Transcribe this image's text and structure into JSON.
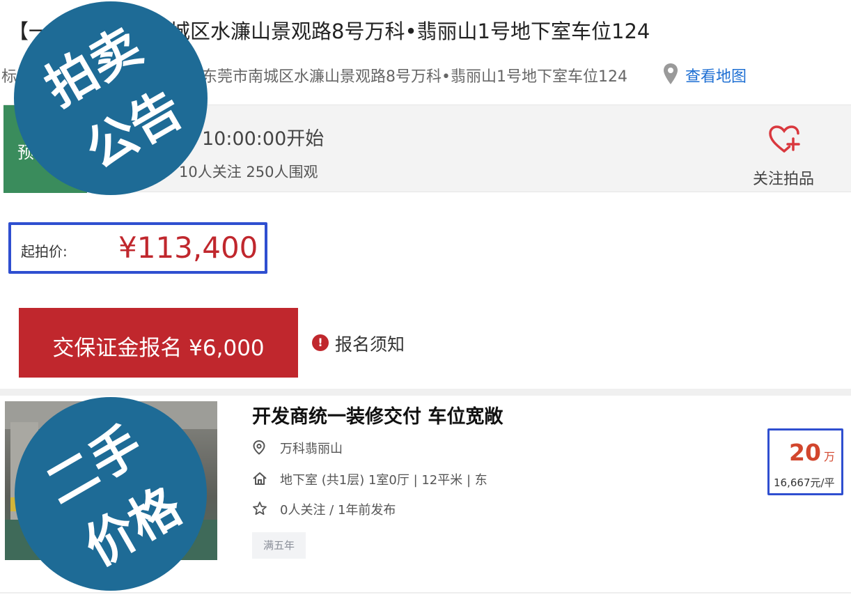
{
  "header": {
    "title": "【一拍】东莞市南城区水濂山景观路8号万科•翡丽山1号地下室车位124",
    "address_prefix": "标",
    "address": "东莞市南城区水濂山景观路8号万科•翡丽山1号地下室车位124",
    "map_link": "查看地图"
  },
  "status": {
    "badge": "预",
    "start_time": "10:00:00开始",
    "stats": "10人关注  250人围观",
    "follow_label": "关注拍品"
  },
  "auction": {
    "start_price_label": "起拍价:",
    "start_price": "¥113,400",
    "signup_button": "交保证金报名 ¥6,000",
    "notice_icon": "!",
    "notice_text": "报名须知"
  },
  "listing": {
    "title": "开发商统一装修交付 车位宽敞",
    "location": "万科翡丽山",
    "info": "地下室 (共1层) 1室0厅 | 12平米 | 东",
    "follow": "0人关注 / 1年前发布",
    "tag": "满五年",
    "total_price": "20",
    "total_unit": "万",
    "unit_price": "16,667元/平"
  },
  "overlays": {
    "auction_notice": [
      "拍卖",
      "公告"
    ],
    "second_hand_price": [
      "二手",
      "价格"
    ]
  },
  "colors": {
    "accent_red": "#c0272d",
    "overlay_blue": "#1e6b96",
    "highlight_border": "#2f4fd0",
    "status_green": "#3a8c5c",
    "link_blue": "#1e6fd3"
  },
  "icons": {
    "pin": "map-pin-icon",
    "follow": "heart-plus-icon",
    "notice": "exclamation-circle-icon",
    "location": "location-icon",
    "house": "house-icon",
    "star": "star-icon"
  }
}
